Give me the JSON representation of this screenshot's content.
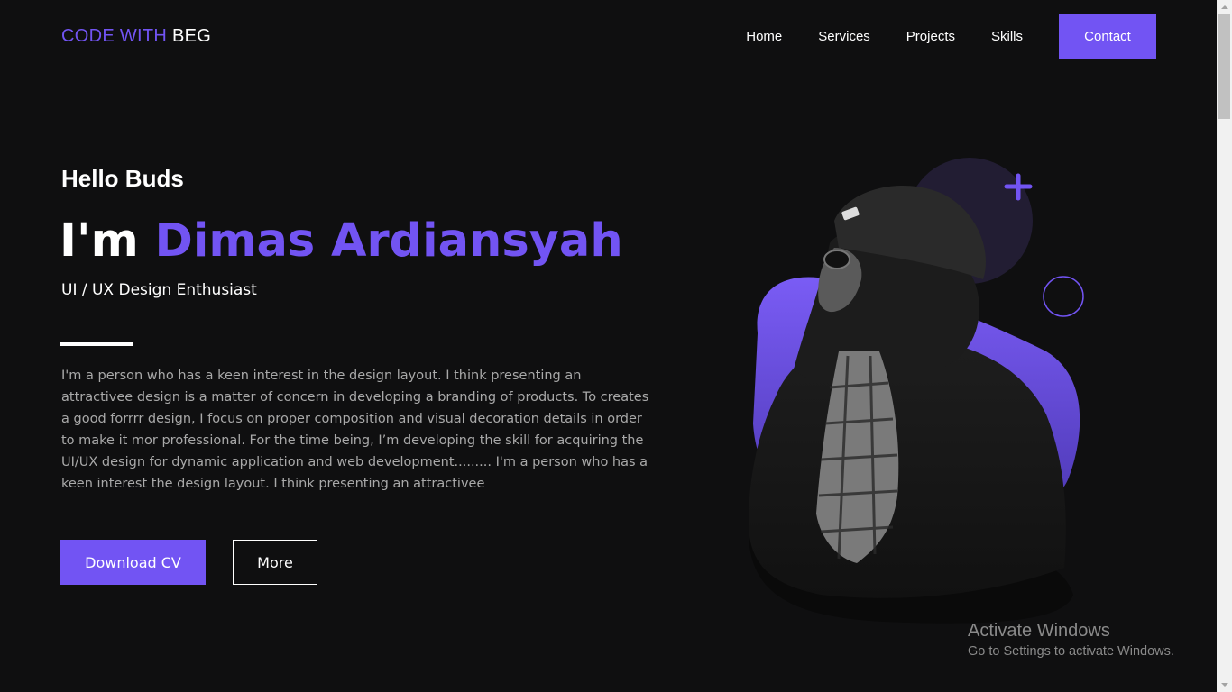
{
  "brand": {
    "part1": "CODE WITH",
    "part2": "BEG"
  },
  "nav": {
    "home": "Home",
    "services": "Services",
    "projects": "Projects",
    "skills": "Skills",
    "contact": "Contact"
  },
  "hero": {
    "greeting": "Hello Buds",
    "name_prefix": "I'm",
    "name": "Dimas Ardiansyah",
    "role": "UI / UX Design Enthusiast",
    "description": "I'm a person who has a keen interest in the design layout. I think presenting an attractivee design is a matter of concern in developing a branding of products. To creates a good forrrr design, I focus on proper composition and visual decoration details in order to make it mor professional. For the time being, I’m developing the skill for acquiring the UI/UX design for dynamic application and web development......... I'm a person who has a keen interest the design layout. I think presenting an attractivee",
    "primary_button": "Download CV",
    "secondary_button": "More"
  },
  "watermark": {
    "title": "Activate Windows",
    "subtitle": "Go to Settings to activate Windows."
  },
  "colors": {
    "accent": "#7254f3",
    "background": "#0f0f10",
    "body_text": "#a9a9a9"
  },
  "icons": {
    "plus": "plus-icon",
    "ring": "circle-outline-icon"
  }
}
